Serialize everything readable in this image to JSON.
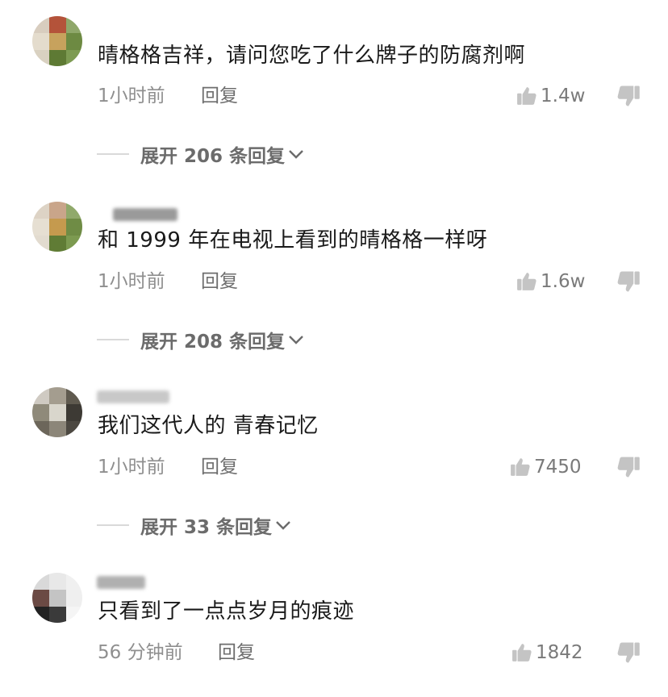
{
  "colors": {
    "text_primary": "#1a1a1a",
    "text_secondary": "#8f8f8f",
    "icon_gray": "#c4c4c4"
  },
  "comments": [
    {
      "text": "晴格格吉祥，请问您吃了什么牌子的防腐剂啊",
      "time": "1小时前",
      "reply_label": "回复",
      "likes": "1.4w",
      "expand_label": "展开 206 条回复"
    },
    {
      "text": "和 1999 年在电视上看到的晴格格一样呀",
      "time": "1小时前",
      "reply_label": "回复",
      "likes": "1.6w",
      "expand_label": "展开 208 条回复"
    },
    {
      "text": "我们这代人的 青春记忆",
      "time": "1小时前",
      "reply_label": "回复",
      "likes": "7450",
      "expand_label": "展开 33 条回复"
    },
    {
      "text": "只看到了一点点岁月的痕迹",
      "time": "56 分钟前",
      "reply_label": "回复",
      "likes": "1842"
    }
  ],
  "icons": {
    "like": "thumbs-up-icon",
    "dislike": "thumbs-down-icon",
    "expand": "chevron-down-icon"
  }
}
